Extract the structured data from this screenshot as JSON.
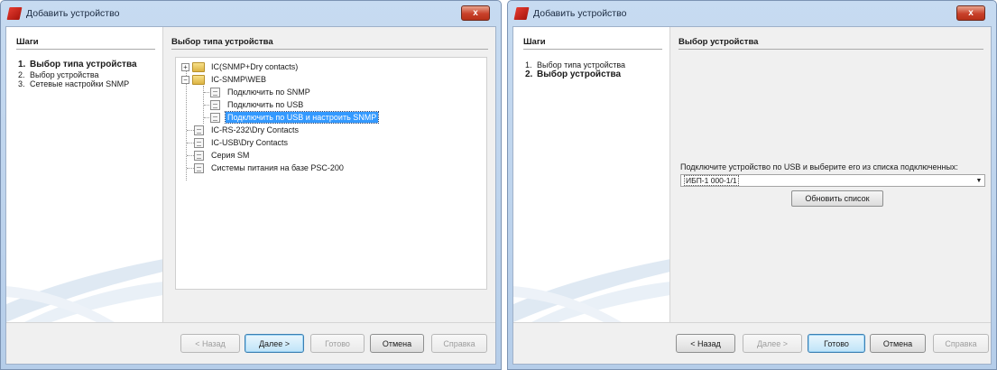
{
  "left_window": {
    "title": "Добавить устройство",
    "close_label": "x",
    "steps_title": "Шаги",
    "steps": [
      {
        "num": "1.",
        "label": "Выбор типа устройства"
      },
      {
        "num": "2.",
        "label": "Выбор устройства"
      },
      {
        "num": "3.",
        "label": "Сетевые настройки SNMP"
      }
    ],
    "main_title": "Выбор типа устройства",
    "tree": [
      {
        "label": "IC(SNMP+Dry contacts)"
      },
      {
        "label": "IC-SNMP\\WEB"
      },
      {
        "label": "Подключить по SNMP"
      },
      {
        "label": "Подключить по USB"
      },
      {
        "label": "Подключить по USB и настроить SNMP"
      },
      {
        "label": "IC-RS-232\\Dry Contacts"
      },
      {
        "label": "IC-USB\\Dry Contacts"
      },
      {
        "label": "Серия SM"
      },
      {
        "label": "Системы питания на базе PSC-200"
      }
    ],
    "buttons": {
      "back": "< Назад",
      "next": "Далее >",
      "finish": "Готово",
      "cancel": "Отмена",
      "help": "Справка"
    }
  },
  "right_window": {
    "title": "Добавить устройство",
    "close_label": "x",
    "steps_title": "Шаги",
    "steps": [
      {
        "num": "1.",
        "label": "Выбор типа устройства"
      },
      {
        "num": "2.",
        "label": "Выбор устройства"
      }
    ],
    "main_title": "Выбор устройства",
    "prompt": "Подключите устройство по USB и выберите его из списка подключенных:",
    "device_select_value": "ИБП-1 000-1/1",
    "refresh_label": "Обновить список",
    "buttons": {
      "back": "< Назад",
      "next": "Далее >",
      "finish": "Готово",
      "cancel": "Отмена",
      "help": "Справка"
    }
  },
  "icons": {
    "app": "app-logo-icon",
    "folder": "folder-icon",
    "device": "device-icon"
  },
  "colors": {
    "selection": "#3399ff",
    "close": "#c8402a",
    "frame": "#b5cde9"
  }
}
